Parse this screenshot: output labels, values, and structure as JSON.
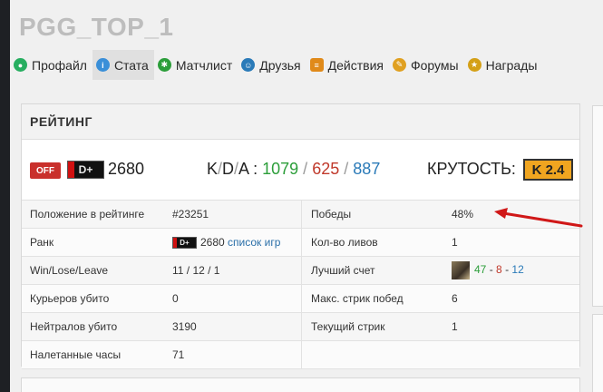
{
  "profile": {
    "username": "PGG_TOP_1"
  },
  "tabs": [
    {
      "label": "Профайл",
      "icon": "profile-icon",
      "color": "#27ae60"
    },
    {
      "label": "Стата",
      "icon": "stats-icon",
      "color": "#3a8fd8",
      "active": true
    },
    {
      "label": "Матчлист",
      "icon": "matchlist-icon",
      "color": "#2c9e3a"
    },
    {
      "label": "Друзья",
      "icon": "friends-icon",
      "color": "#2a7ab8"
    },
    {
      "label": "Действия",
      "icon": "actions-icon",
      "color": "#e08a1a"
    },
    {
      "label": "Форумы",
      "icon": "forums-icon",
      "color": "#e0a020"
    },
    {
      "label": "Награды",
      "icon": "awards-icon",
      "color": "#d4a017"
    }
  ],
  "rating_panel": {
    "title": "РЕЙТИНГ",
    "off_label": "OFF",
    "rank_badge": "D+",
    "rating_value": "2680",
    "kda": {
      "k_letter": "K",
      "d_letter": "D",
      "a_letter": "A",
      "slash": "/",
      "colon": ":",
      "kills": "1079",
      "deaths": "625",
      "assists": "887"
    },
    "krutost_label": "КРУТОСТЬ:",
    "krutost_value": "K 2.4"
  },
  "stats": {
    "rows": [
      {
        "left_label": "Положение в рейтинге",
        "left_value": "#23251",
        "right_label": "Победы",
        "right_value": "48%"
      },
      {
        "left_label": "Ранк",
        "left_value": "2680",
        "left_link": "список игр",
        "right_label": "Кол-во ливов",
        "right_value": "1"
      },
      {
        "left_label": "Win/Lose/Leave",
        "left_value": "11 / 12 / 1",
        "right_label": "Лучший счет",
        "best_k": "47",
        "best_d": "8",
        "best_a": "12",
        "dash": "-"
      },
      {
        "left_label": "Курьеров убито",
        "left_value": "0",
        "right_label": "Макс. стрик побед",
        "right_value": "6"
      },
      {
        "left_label": "Нейтралов убито",
        "left_value": "3190",
        "right_label": "Текущий стрик",
        "right_value": "1"
      },
      {
        "left_label": "Налетанные часы",
        "left_value": "71",
        "right_label": "",
        "right_value": ""
      }
    ]
  },
  "colors": {
    "kills": "#2c9e3a",
    "deaths": "#c0392b",
    "assists": "#2a7ab8",
    "off_badge": "#c9302c",
    "krutost_badge": "#f0a520",
    "arrow": "#d01818"
  }
}
